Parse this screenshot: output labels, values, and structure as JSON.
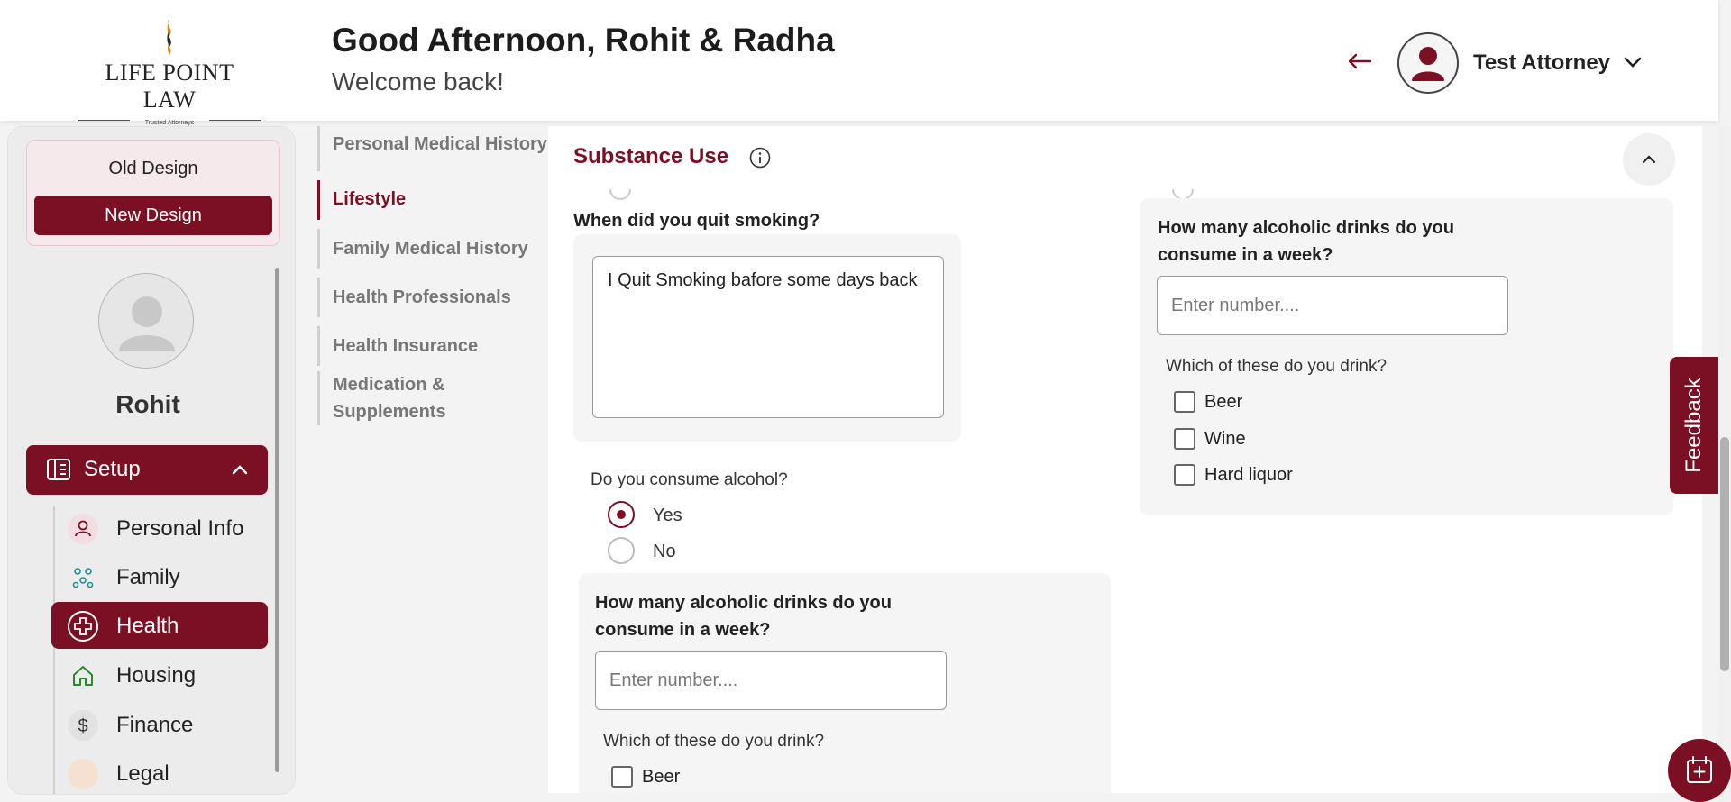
{
  "header": {
    "logo_text": "LIFE POINT LAW",
    "logo_tagline": "Trusted Attorneys",
    "greeting_title": "Good Afternoon, Rohit & Radha",
    "greeting_subtitle": "Welcome back!",
    "user_name": "Test Attorney"
  },
  "sidebar": {
    "old_design": "Old Design",
    "new_design": "New Design",
    "user_name": "Rohit",
    "setup_label": "Setup",
    "items": [
      {
        "label": "Personal Info",
        "icon": "person-icon"
      },
      {
        "label": "Family",
        "icon": "family-icon"
      },
      {
        "label": "Health",
        "icon": "health-cross-icon",
        "active": true
      },
      {
        "label": "Housing",
        "icon": "house-icon"
      },
      {
        "label": "Finance",
        "icon": "dollar-icon"
      },
      {
        "label": "Legal",
        "icon": "legal-icon"
      }
    ]
  },
  "subnav": {
    "items": [
      {
        "label": "Personal Medical History"
      },
      {
        "label": "Lifestyle",
        "active": true
      },
      {
        "label": "Family Medical History"
      },
      {
        "label": "Health Professionals"
      },
      {
        "label": "Health Insurance"
      },
      {
        "label": "Medication &\nSupplements"
      }
    ]
  },
  "main": {
    "section_title": "Substance Use",
    "quit_question": "When did you quit smoking?",
    "quit_answer": "I Quit Smoking bafore some days back",
    "alcohol_question": "Do you consume alcohol?",
    "alcohol_options": [
      "Yes",
      "No"
    ],
    "alcohol_selected": "Yes",
    "drinks_question": "How many alcoholic drinks do you consume in a week?",
    "drinks_placeholder": "Enter number....",
    "which_drink": "Which of these do you drink?",
    "drink_options": [
      "Beer",
      "Wine",
      "Hard liquor"
    ]
  },
  "floating": {
    "feedback": "Feedback"
  },
  "colors": {
    "brand": "#7b0f24",
    "sidebar_bg": "#ececec",
    "card_bg": "#f5f5f6"
  }
}
